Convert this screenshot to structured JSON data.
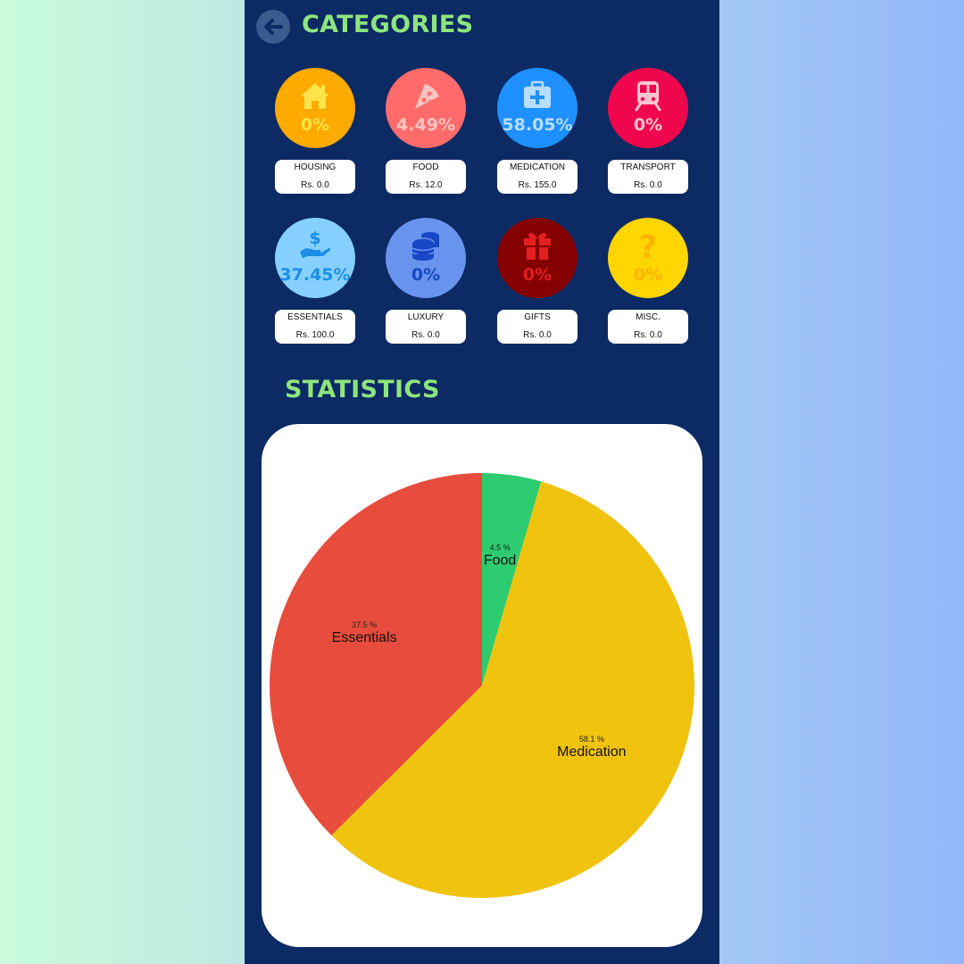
{
  "header": {
    "title": "CATEGORIES"
  },
  "categories": [
    {
      "name": "HOUSING",
      "percent": "0%",
      "amount": "Rs. 0.0",
      "icon": "house-icon",
      "bg": "#ffaa00",
      "fg": "#ffe44a"
    },
    {
      "name": "FOOD",
      "percent": "4.49%",
      "amount": "Rs. 12.0",
      "icon": "pizza-icon",
      "bg": "#ff6b6b",
      "fg": "#ffc4c2"
    },
    {
      "name": "MEDICATION",
      "percent": "58.05%",
      "amount": "Rs. 155.0",
      "icon": "medkit-icon",
      "bg": "#1e90ff",
      "fg": "#b9ddff"
    },
    {
      "name": "TRANSPORT",
      "percent": "0%",
      "amount": "Rs. 0.0",
      "icon": "train-icon",
      "bg": "#f0064d",
      "fg": "#ffc3d0"
    },
    {
      "name": "ESSENTIALS",
      "percent": "37.45%",
      "amount": "Rs. 100.0",
      "icon": "hand-money-icon",
      "bg": "#86d0ff",
      "fg": "#1b8fe8"
    },
    {
      "name": "LUXURY",
      "percent": "0%",
      "amount": "Rs. 0.0",
      "icon": "coins-icon",
      "bg": "#6994ee",
      "fg": "#1747c4"
    },
    {
      "name": "GIFTS",
      "percent": "0%",
      "amount": "Rs. 0.0",
      "icon": "gift-icon",
      "bg": "#850000",
      "fg": "#e51f1f"
    },
    {
      "name": "MISC.",
      "percent": "0%",
      "amount": "Rs. 0.0",
      "icon": "question-icon",
      "bg": "#ffd600",
      "fg": "#ffb300"
    }
  ],
  "statistics": {
    "title": "STATISTICS"
  },
  "chart_data": {
    "type": "pie",
    "slices": [
      {
        "label": "Food",
        "pct_label": "4.5 %",
        "value": 4.5,
        "color": "#2ecc71"
      },
      {
        "label": "Medication",
        "pct_label": "58.1 %",
        "value": 58.1,
        "color": "#f0c30f"
      },
      {
        "label": "Essentials",
        "pct_label": "37.5 %",
        "value": 37.5,
        "color": "#e74c3c"
      }
    ]
  },
  "colors": {
    "panel": "#0c2a63",
    "heading": "#8ee57e"
  }
}
